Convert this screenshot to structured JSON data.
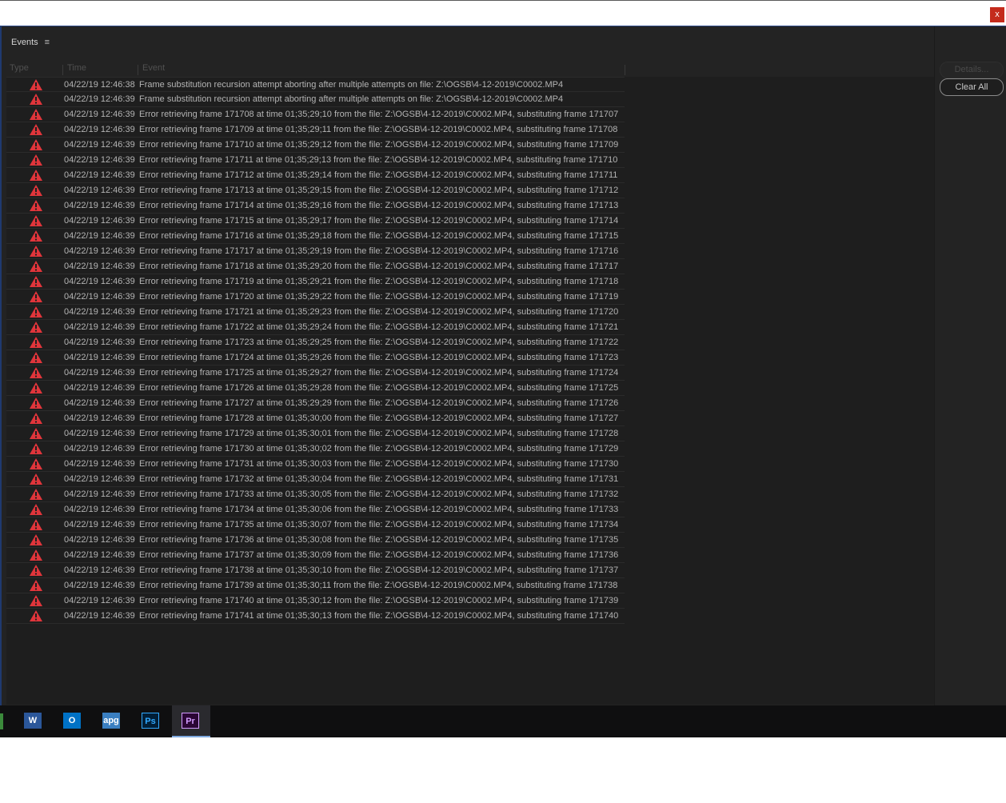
{
  "window": {
    "close_label": "x"
  },
  "panel": {
    "title": "Events",
    "menu_glyph": "≡"
  },
  "columns": {
    "type": "Type",
    "time": "Time",
    "event": "Event"
  },
  "buttons": {
    "details": "Details...",
    "clear_all": "Clear All"
  },
  "taskbar": {
    "items": [
      {
        "name": "Word",
        "label": "W",
        "color": "#2b579a"
      },
      {
        "name": "Outlook",
        "label": "O",
        "color": "#0072c6"
      },
      {
        "name": "apg",
        "label": "apg",
        "color": "#3a7fc1"
      },
      {
        "name": "Photoshop",
        "label": "Ps",
        "color": "#001e36",
        "fg": "#31a8ff"
      },
      {
        "name": "Premiere",
        "label": "Pr",
        "color": "#2a0634",
        "fg": "#d29cff",
        "active": true
      }
    ]
  },
  "colors": {
    "warning": "#e0353b",
    "panel_bg": "#232323",
    "list_bg": "#1e1e1e"
  },
  "events": [
    {
      "time": "04/22/19 12:46:38",
      "event": "Frame substitution recursion attempt aborting after multiple attempts on file: Z:\\OGSB\\4-12-2019\\C0002.MP4"
    },
    {
      "time": "04/22/19 12:46:39",
      "event": "Frame substitution recursion attempt aborting after multiple attempts on file: Z:\\OGSB\\4-12-2019\\C0002.MP4"
    },
    {
      "time": "04/22/19 12:46:39",
      "event": "Error retrieving frame 171708 at time 01;35;29;10 from the file: Z:\\OGSB\\4-12-2019\\C0002.MP4, substituting frame 171707"
    },
    {
      "time": "04/22/19 12:46:39",
      "event": "Error retrieving frame 171709 at time 01;35;29;11 from the file: Z:\\OGSB\\4-12-2019\\C0002.MP4, substituting frame 171708"
    },
    {
      "time": "04/22/19 12:46:39",
      "event": "Error retrieving frame 171710 at time 01;35;29;12 from the file: Z:\\OGSB\\4-12-2019\\C0002.MP4, substituting frame 171709"
    },
    {
      "time": "04/22/19 12:46:39",
      "event": "Error retrieving frame 171711 at time 01;35;29;13 from the file: Z:\\OGSB\\4-12-2019\\C0002.MP4, substituting frame 171710"
    },
    {
      "time": "04/22/19 12:46:39",
      "event": "Error retrieving frame 171712 at time 01;35;29;14 from the file: Z:\\OGSB\\4-12-2019\\C0002.MP4, substituting frame 171711"
    },
    {
      "time": "04/22/19 12:46:39",
      "event": "Error retrieving frame 171713 at time 01;35;29;15 from the file: Z:\\OGSB\\4-12-2019\\C0002.MP4, substituting frame 171712"
    },
    {
      "time": "04/22/19 12:46:39",
      "event": "Error retrieving frame 171714 at time 01;35;29;16 from the file: Z:\\OGSB\\4-12-2019\\C0002.MP4, substituting frame 171713"
    },
    {
      "time": "04/22/19 12:46:39",
      "event": "Error retrieving frame 171715 at time 01;35;29;17 from the file: Z:\\OGSB\\4-12-2019\\C0002.MP4, substituting frame 171714"
    },
    {
      "time": "04/22/19 12:46:39",
      "event": "Error retrieving frame 171716 at time 01;35;29;18 from the file: Z:\\OGSB\\4-12-2019\\C0002.MP4, substituting frame 171715"
    },
    {
      "time": "04/22/19 12:46:39",
      "event": "Error retrieving frame 171717 at time 01;35;29;19 from the file: Z:\\OGSB\\4-12-2019\\C0002.MP4, substituting frame 171716"
    },
    {
      "time": "04/22/19 12:46:39",
      "event": "Error retrieving frame 171718 at time 01;35;29;20 from the file: Z:\\OGSB\\4-12-2019\\C0002.MP4, substituting frame 171717"
    },
    {
      "time": "04/22/19 12:46:39",
      "event": "Error retrieving frame 171719 at time 01;35;29;21 from the file: Z:\\OGSB\\4-12-2019\\C0002.MP4, substituting frame 171718"
    },
    {
      "time": "04/22/19 12:46:39",
      "event": "Error retrieving frame 171720 at time 01;35;29;22 from the file: Z:\\OGSB\\4-12-2019\\C0002.MP4, substituting frame 171719"
    },
    {
      "time": "04/22/19 12:46:39",
      "event": "Error retrieving frame 171721 at time 01;35;29;23 from the file: Z:\\OGSB\\4-12-2019\\C0002.MP4, substituting frame 171720"
    },
    {
      "time": "04/22/19 12:46:39",
      "event": "Error retrieving frame 171722 at time 01;35;29;24 from the file: Z:\\OGSB\\4-12-2019\\C0002.MP4, substituting frame 171721"
    },
    {
      "time": "04/22/19 12:46:39",
      "event": "Error retrieving frame 171723 at time 01;35;29;25 from the file: Z:\\OGSB\\4-12-2019\\C0002.MP4, substituting frame 171722"
    },
    {
      "time": "04/22/19 12:46:39",
      "event": "Error retrieving frame 171724 at time 01;35;29;26 from the file: Z:\\OGSB\\4-12-2019\\C0002.MP4, substituting frame 171723"
    },
    {
      "time": "04/22/19 12:46:39",
      "event": "Error retrieving frame 171725 at time 01;35;29;27 from the file: Z:\\OGSB\\4-12-2019\\C0002.MP4, substituting frame 171724"
    },
    {
      "time": "04/22/19 12:46:39",
      "event": "Error retrieving frame 171726 at time 01;35;29;28 from the file: Z:\\OGSB\\4-12-2019\\C0002.MP4, substituting frame 171725"
    },
    {
      "time": "04/22/19 12:46:39",
      "event": "Error retrieving frame 171727 at time 01;35;29;29 from the file: Z:\\OGSB\\4-12-2019\\C0002.MP4, substituting frame 171726"
    },
    {
      "time": "04/22/19 12:46:39",
      "event": "Error retrieving frame 171728 at time 01;35;30;00 from the file: Z:\\OGSB\\4-12-2019\\C0002.MP4, substituting frame 171727"
    },
    {
      "time": "04/22/19 12:46:39",
      "event": "Error retrieving frame 171729 at time 01;35;30;01 from the file: Z:\\OGSB\\4-12-2019\\C0002.MP4, substituting frame 171728"
    },
    {
      "time": "04/22/19 12:46:39",
      "event": "Error retrieving frame 171730 at time 01;35;30;02 from the file: Z:\\OGSB\\4-12-2019\\C0002.MP4, substituting frame 171729"
    },
    {
      "time": "04/22/19 12:46:39",
      "event": "Error retrieving frame 171731 at time 01;35;30;03 from the file: Z:\\OGSB\\4-12-2019\\C0002.MP4, substituting frame 171730"
    },
    {
      "time": "04/22/19 12:46:39",
      "event": "Error retrieving frame 171732 at time 01;35;30;04 from the file: Z:\\OGSB\\4-12-2019\\C0002.MP4, substituting frame 171731"
    },
    {
      "time": "04/22/19 12:46:39",
      "event": "Error retrieving frame 171733 at time 01;35;30;05 from the file: Z:\\OGSB\\4-12-2019\\C0002.MP4, substituting frame 171732"
    },
    {
      "time": "04/22/19 12:46:39",
      "event": "Error retrieving frame 171734 at time 01;35;30;06 from the file: Z:\\OGSB\\4-12-2019\\C0002.MP4, substituting frame 171733"
    },
    {
      "time": "04/22/19 12:46:39",
      "event": "Error retrieving frame 171735 at time 01;35;30;07 from the file: Z:\\OGSB\\4-12-2019\\C0002.MP4, substituting frame 171734"
    },
    {
      "time": "04/22/19 12:46:39",
      "event": "Error retrieving frame 171736 at time 01;35;30;08 from the file: Z:\\OGSB\\4-12-2019\\C0002.MP4, substituting frame 171735"
    },
    {
      "time": "04/22/19 12:46:39",
      "event": "Error retrieving frame 171737 at time 01;35;30;09 from the file: Z:\\OGSB\\4-12-2019\\C0002.MP4, substituting frame 171736"
    },
    {
      "time": "04/22/19 12:46:39",
      "event": "Error retrieving frame 171738 at time 01;35;30;10 from the file: Z:\\OGSB\\4-12-2019\\C0002.MP4, substituting frame 171737"
    },
    {
      "time": "04/22/19 12:46:39",
      "event": "Error retrieving frame 171739 at time 01;35;30;11 from the file: Z:\\OGSB\\4-12-2019\\C0002.MP4, substituting frame 171738"
    },
    {
      "time": "04/22/19 12:46:39",
      "event": "Error retrieving frame 171740 at time 01;35;30;12 from the file: Z:\\OGSB\\4-12-2019\\C0002.MP4, substituting frame 171739"
    },
    {
      "time": "04/22/19 12:46:39",
      "event": "Error retrieving frame 171741 at time 01;35;30;13 from the file: Z:\\OGSB\\4-12-2019\\C0002.MP4, substituting frame 171740"
    }
  ]
}
